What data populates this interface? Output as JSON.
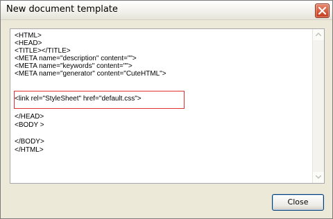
{
  "window": {
    "title": "New document template"
  },
  "icons": {
    "close": "close-x-icon",
    "scroll_up": "arrow-up-icon",
    "scroll_down": "arrow-down-icon"
  },
  "colors": {
    "highlight_border": "#e0302f",
    "close_x_bg": "#c84a2c"
  },
  "editor": {
    "lines": [
      "<HTML>",
      "<HEAD>",
      "<TITLE></TITLE>",
      "<META name=\"description\" content=\"\">",
      "<META name=\"keywords\" content=\"\">",
      "<META name=\"generator\" content=\"CuteHTML\">",
      "",
      "<link rel=\"StyleSheet\" href=\"default.css\">",
      "",
      "</HEAD>",
      "<BODY >",
      "",
      "</BODY>",
      "</HTML>"
    ]
  },
  "buttons": {
    "close_label": "Close"
  }
}
